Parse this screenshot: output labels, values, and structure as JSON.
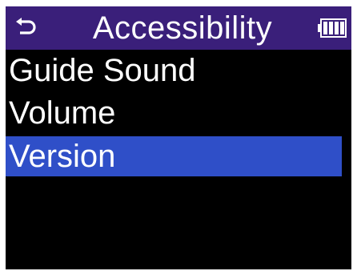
{
  "header": {
    "title": "Accessibility",
    "back_icon": "return-arrow-icon",
    "battery_icon": "battery-icon",
    "battery_level": 1.0
  },
  "menu": {
    "items": [
      {
        "label": "Guide Sound",
        "selected": false
      },
      {
        "label": "Volume",
        "selected": false
      },
      {
        "label": "Version",
        "selected": true
      }
    ]
  },
  "colors": {
    "header_bg": "#3a1f7a",
    "screen_bg": "#000000",
    "selection_bg": "#2f4fc8",
    "text": "#ffffff"
  }
}
